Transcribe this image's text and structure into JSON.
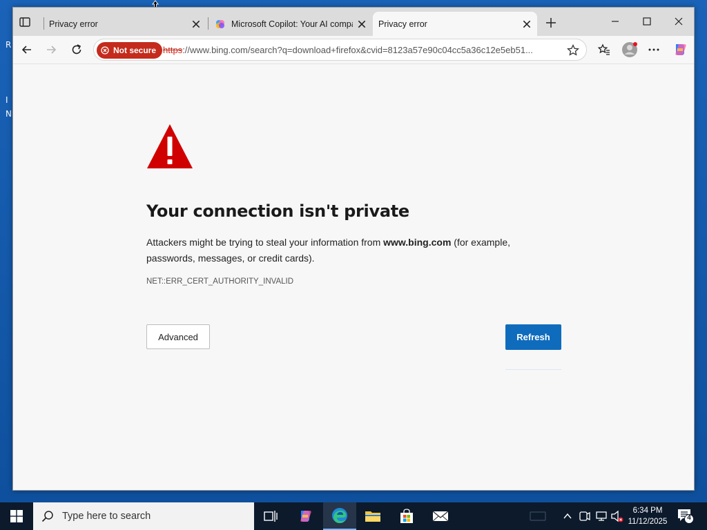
{
  "desktop": {
    "icon_fragments": [
      "R",
      "I",
      "N"
    ]
  },
  "browser": {
    "tabs": [
      {
        "title": "Privacy error",
        "active": false
      },
      {
        "title": "Microsoft Copilot: Your AI compa",
        "active": false
      },
      {
        "title": "Privacy error",
        "active": true
      }
    ],
    "address_bar": {
      "security_badge": "Not secure",
      "url_scheme": "https",
      "url_rest": "://www.bing.com/search?q=download+firefox&cvid=8123a57e90c04cc5a36c12e5eb51..."
    }
  },
  "error_page": {
    "headline": "Your connection isn't private",
    "message_pre": "Attackers might be trying to steal your information from ",
    "message_domain": "www.bing.com",
    "message_post": " (for example, passwords, messages, or credit cards).",
    "error_code": "NET::ERR_CERT_AUTHORITY_INVALID",
    "advanced_label": "Advanced",
    "refresh_label": "Refresh"
  },
  "taskbar": {
    "search_placeholder": "Type here to search",
    "time": "6:34 PM",
    "date": "11/12/2025",
    "notification_count": "4"
  },
  "colors": {
    "accent": "#0f6cbd",
    "danger": "#c42b1c",
    "warning_icon": "#d00000"
  }
}
